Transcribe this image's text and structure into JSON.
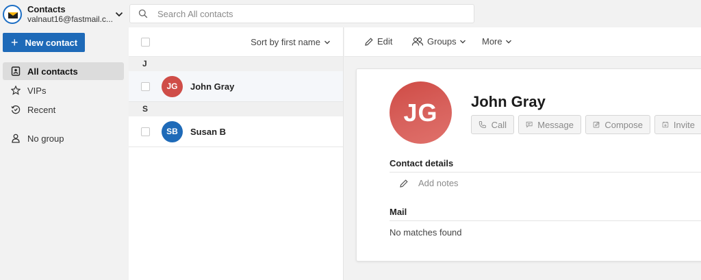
{
  "account": {
    "app_title": "Contacts",
    "email": "valnaut16@fastmail.c..."
  },
  "sidebar": {
    "new_contact_label": "New contact",
    "items": [
      {
        "label": "All contacts",
        "icon": "address-book-icon",
        "active": true
      },
      {
        "label": "VIPs",
        "icon": "star-icon",
        "active": false
      },
      {
        "label": "Recent",
        "icon": "recent-clock-icon",
        "active": false
      },
      {
        "label": "No group",
        "icon": "person-icon",
        "active": false
      }
    ]
  },
  "search": {
    "placeholder": "Search All contacts"
  },
  "list": {
    "sort_label": "Sort by first name",
    "groups": [
      {
        "letter": "J",
        "contacts": [
          {
            "initials": "JG",
            "name": "John Gray",
            "color": "#cf4d48",
            "selected": true
          }
        ]
      },
      {
        "letter": "S",
        "contacts": [
          {
            "initials": "SB",
            "name": "Susan B",
            "color": "#1e6ab8",
            "selected": false
          }
        ]
      }
    ]
  },
  "toolbar": {
    "edit_label": "Edit",
    "groups_label": "Groups",
    "more_label": "More"
  },
  "detail": {
    "initials": "JG",
    "name": "John Gray",
    "actions": {
      "call": "Call",
      "message": "Message",
      "compose": "Compose",
      "invite": "Invite"
    },
    "contact_details_title": "Contact details",
    "add_notes_label": "Add notes",
    "mail_title": "Mail",
    "mail_empty": "No matches found"
  },
  "colors": {
    "accent": "#1e6ab8",
    "avatar_jg": "#cf4d48",
    "avatar_sb": "#1e6ab8"
  }
}
